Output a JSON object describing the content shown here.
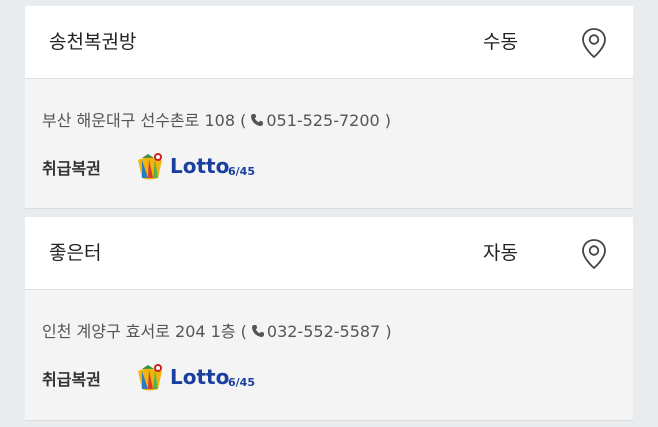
{
  "stores": [
    {
      "name": "송천복권방",
      "type": "수동",
      "address": "부산 해운대구 선수촌로 108",
      "phone": "051-525-7200",
      "handled_label": "취급복권",
      "lotto_text": "Lotto",
      "lotto_suffix": "6/45",
      "map_icon": "map-pin-icon"
    },
    {
      "name": "좋은터",
      "type": "자동",
      "address": "인천 계양구 효서로 204 1층",
      "phone": "032-552-5587",
      "handled_label": "취급복권",
      "lotto_text": "Lotto",
      "lotto_suffix": "6/45",
      "map_icon": "map-pin-icon"
    }
  ],
  "colors": {
    "background": "#e9ecef",
    "card_header": "#ffffff",
    "card_body": "#f4f4f4",
    "lotto_blue": "#1a3f9e"
  }
}
